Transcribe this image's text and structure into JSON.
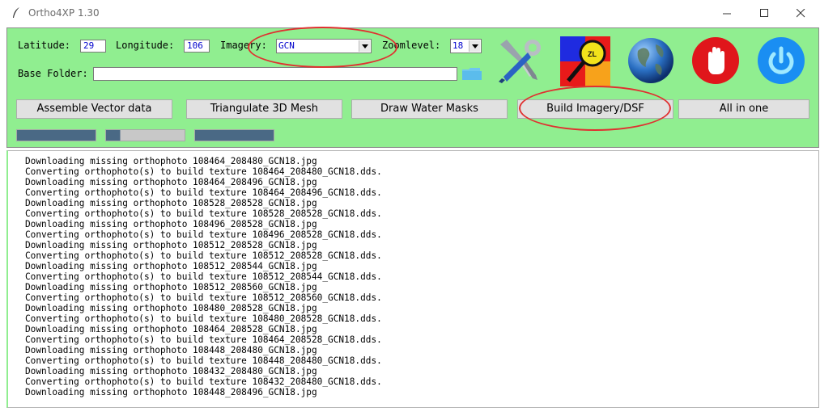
{
  "window": {
    "title": "Ortho4XP 1.30",
    "controls": [
      "minimize-icon",
      "maximize-icon",
      "close-icon"
    ]
  },
  "form": {
    "latitude_label": "Latitude:",
    "latitude_value": "29",
    "longitude_label": "Longitude:",
    "longitude_value": "106",
    "imagery_label": "Imagery:",
    "imagery_value": "GCN",
    "zoomlevel_label": "Zoomlevel:",
    "zoomlevel_value": "18",
    "base_folder_label": "Base Folder:",
    "base_folder_value": ""
  },
  "toolbar": {
    "icons": [
      "tools-icon",
      "zoomlevel-map-icon",
      "globe-icon",
      "stop-hand-icon",
      "power-icon"
    ],
    "zl_badge": "ZL"
  },
  "actions": {
    "assemble": "Assemble Vector data",
    "triangulate": "Triangulate 3D Mesh",
    "water": "Draw Water Masks",
    "build": "Build Imagery/DSF",
    "all": "All in one"
  },
  "progress": {
    "bar1": 1.0,
    "bar2": 0.18,
    "bar3": 1.0
  },
  "colors": {
    "panel_bg": "#90ee90",
    "progress_fill": "#4a6985",
    "highlight_ellipse": "#e03030",
    "entry_text": "#0000cc"
  },
  "log": [
    "Downloading missing orthophoto 108464_208480_GCN18.jpg",
    "Converting orthophoto(s) to build texture 108464_208480_GCN18.dds.",
    "Downloading missing orthophoto 108464_208496_GCN18.jpg",
    "Converting orthophoto(s) to build texture 108464_208496_GCN18.dds.",
    "Downloading missing orthophoto 108528_208528_GCN18.jpg",
    "Converting orthophoto(s) to build texture 108528_208528_GCN18.dds.",
    "Downloading missing orthophoto 108496_208528_GCN18.jpg",
    "Converting orthophoto(s) to build texture 108496_208528_GCN18.dds.",
    "Downloading missing orthophoto 108512_208528_GCN18.jpg",
    "Converting orthophoto(s) to build texture 108512_208528_GCN18.dds.",
    "Downloading missing orthophoto 108512_208544_GCN18.jpg",
    "Converting orthophoto(s) to build texture 108512_208544_GCN18.dds.",
    "Downloading missing orthophoto 108512_208560_GCN18.jpg",
    "Converting orthophoto(s) to build texture 108512_208560_GCN18.dds.",
    "Downloading missing orthophoto 108480_208528_GCN18.jpg",
    "Converting orthophoto(s) to build texture 108480_208528_GCN18.dds.",
    "Downloading missing orthophoto 108464_208528_GCN18.jpg",
    "Converting orthophoto(s) to build texture 108464_208528_GCN18.dds.",
    "Downloading missing orthophoto 108448_208480_GCN18.jpg",
    "Converting orthophoto(s) to build texture 108448_208480_GCN18.dds.",
    "Downloading missing orthophoto 108432_208480_GCN18.jpg",
    "Converting orthophoto(s) to build texture 108432_208480_GCN18.dds.",
    "Downloading missing orthophoto 108448_208496_GCN18.jpg"
  ]
}
